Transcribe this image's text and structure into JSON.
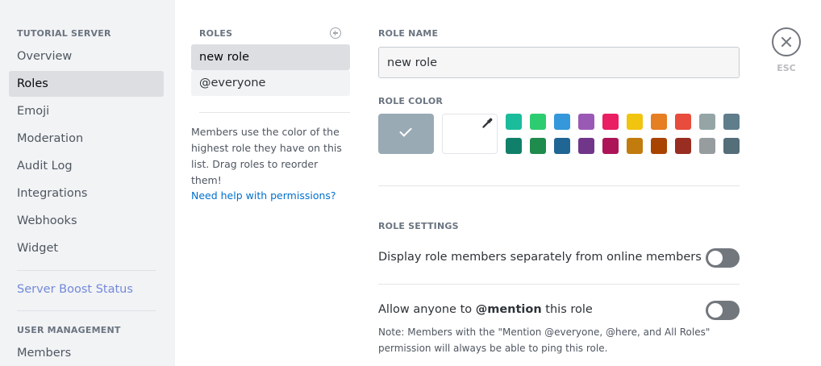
{
  "sidebar": {
    "header": "TUTORIAL SERVER",
    "items": [
      {
        "label": "Overview"
      },
      {
        "label": "Roles"
      },
      {
        "label": "Emoji"
      },
      {
        "label": "Moderation"
      },
      {
        "label": "Audit Log"
      },
      {
        "label": "Integrations"
      },
      {
        "label": "Webhooks"
      },
      {
        "label": "Widget"
      }
    ],
    "boost": "Server Boost Status",
    "user_management_header": "USER MANAGEMENT",
    "members": "Members"
  },
  "roles": {
    "header": "ROLES",
    "items": [
      {
        "label": "new role"
      },
      {
        "label": "@everyone"
      }
    ],
    "help_text": "Members use the color of the highest role they have on this list. Drag roles to reorder them!",
    "permissions_link": "Need help with permissions?"
  },
  "role_name": {
    "label": "ROLE NAME",
    "value": "new role"
  },
  "role_color": {
    "label": "ROLE COLOR",
    "default_color": "#99aab5",
    "swatches_row1": [
      "#1abc9c",
      "#2ecc71",
      "#3498db",
      "#9b59b6",
      "#e91e63",
      "#f1c40f",
      "#e67e22",
      "#e74c3c",
      "#95a5a6",
      "#607d8b"
    ],
    "swatches_row2": [
      "#11806a",
      "#1f8b4c",
      "#206694",
      "#71368a",
      "#ad1457",
      "#c27c0e",
      "#a84300",
      "#992d22",
      "#979c9f",
      "#546e7a"
    ]
  },
  "role_settings": {
    "label": "ROLE SETTINGS",
    "display_separately": "Display role members separately from online members",
    "allow_mention_prefix": "Allow anyone to ",
    "allow_mention_bold": "@mention",
    "allow_mention_suffix": " this role",
    "note": "Note: Members with the \"Mention @everyone, @here, and All Roles\" permission will always be able to ping this role."
  },
  "close": {
    "esc_label": "ESC"
  }
}
